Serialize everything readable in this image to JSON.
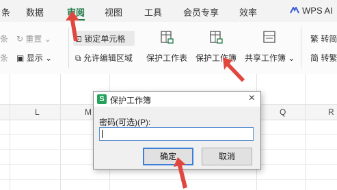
{
  "menu": {
    "tabs": [
      "条",
      "数据",
      "审阅",
      "视图",
      "工具",
      "会员专享",
      "效率"
    ],
    "active_tab": "审阅",
    "wps_ai": "WPS AI"
  },
  "ribbon": {
    "left_items": {
      "row1_cut": "条",
      "redo": "重置",
      "row2_cut": "条",
      "show": "显示"
    },
    "lock_cell": "锁定单元格",
    "allow_edit_range": "允许编辑区域",
    "protect_sheet": "保护工作表",
    "protect_workbook": "保护工作簿",
    "share_workbook": "共享工作簿",
    "right_1": "繁 转简",
    "right_2": "简 转繁"
  },
  "sheet": {
    "columns": [
      "L",
      "M",
      "Q",
      "R"
    ]
  },
  "dialog": {
    "title": "保护工作簿",
    "logo": "S",
    "close": "×",
    "password_label": "密码(可选)(P):",
    "password_value": "",
    "ok": "确定",
    "cancel": "取消"
  },
  "colors": {
    "active_tab": "#1f7a46",
    "annotation_arrow": "#e0473f",
    "dialog_focus": "#3c7fd6"
  }
}
